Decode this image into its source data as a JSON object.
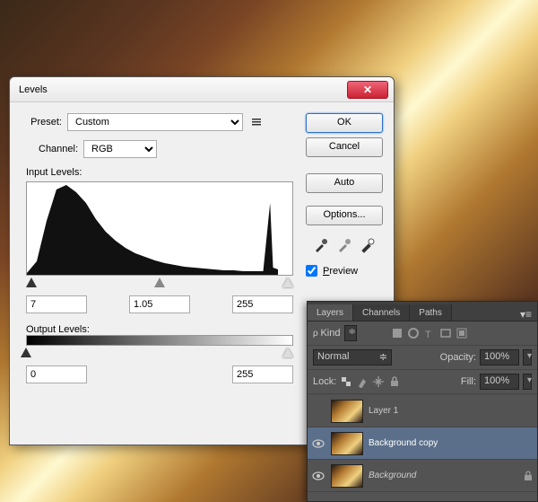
{
  "dialog": {
    "title": "Levels",
    "preset_label": "Preset:",
    "preset_value": "Custom",
    "channel_label": "Channel:",
    "channel_value": "RGB",
    "input_label": "Input Levels:",
    "output_label": "Output Levels:",
    "input": {
      "black": "7",
      "mid": "1.05",
      "white": "255"
    },
    "output": {
      "black": "0",
      "white": "255"
    },
    "buttons": {
      "ok": "OK",
      "cancel": "Cancel",
      "auto": "Auto",
      "options": "Options..."
    },
    "preview_label": "Preview"
  },
  "panel": {
    "tabs": [
      "Layers",
      "Channels",
      "Paths"
    ],
    "kind_label": "Kind",
    "blend_mode": "Normal",
    "opacity_label": "Opacity:",
    "opacity_value": "100%",
    "lock_label": "Lock:",
    "fill_label": "Fill:",
    "fill_value": "100%",
    "layers": [
      {
        "name": "Layer 1",
        "italic": false,
        "selected": false,
        "locked": false,
        "visible": false
      },
      {
        "name": "Background copy",
        "italic": false,
        "selected": true,
        "locked": false,
        "visible": true
      },
      {
        "name": "Background",
        "italic": true,
        "selected": false,
        "locked": true,
        "visible": true
      }
    ]
  },
  "chart_data": {
    "type": "bar",
    "title": "Histogram",
    "xlabel": "",
    "ylabel": "",
    "xlim": [
      0,
      255
    ],
    "ylim": [
      0,
      100
    ],
    "categories": [
      0,
      10,
      20,
      30,
      40,
      50,
      60,
      70,
      80,
      90,
      100,
      110,
      120,
      130,
      140,
      150,
      160,
      170,
      180,
      190,
      200,
      210,
      220,
      230,
      240,
      247,
      250,
      255
    ],
    "values": [
      2,
      15,
      60,
      95,
      100,
      92,
      80,
      62,
      48,
      38,
      30,
      24,
      20,
      16,
      13,
      11,
      9,
      8,
      7,
      6,
      5,
      5,
      4,
      4,
      4,
      80,
      8,
      6
    ]
  }
}
